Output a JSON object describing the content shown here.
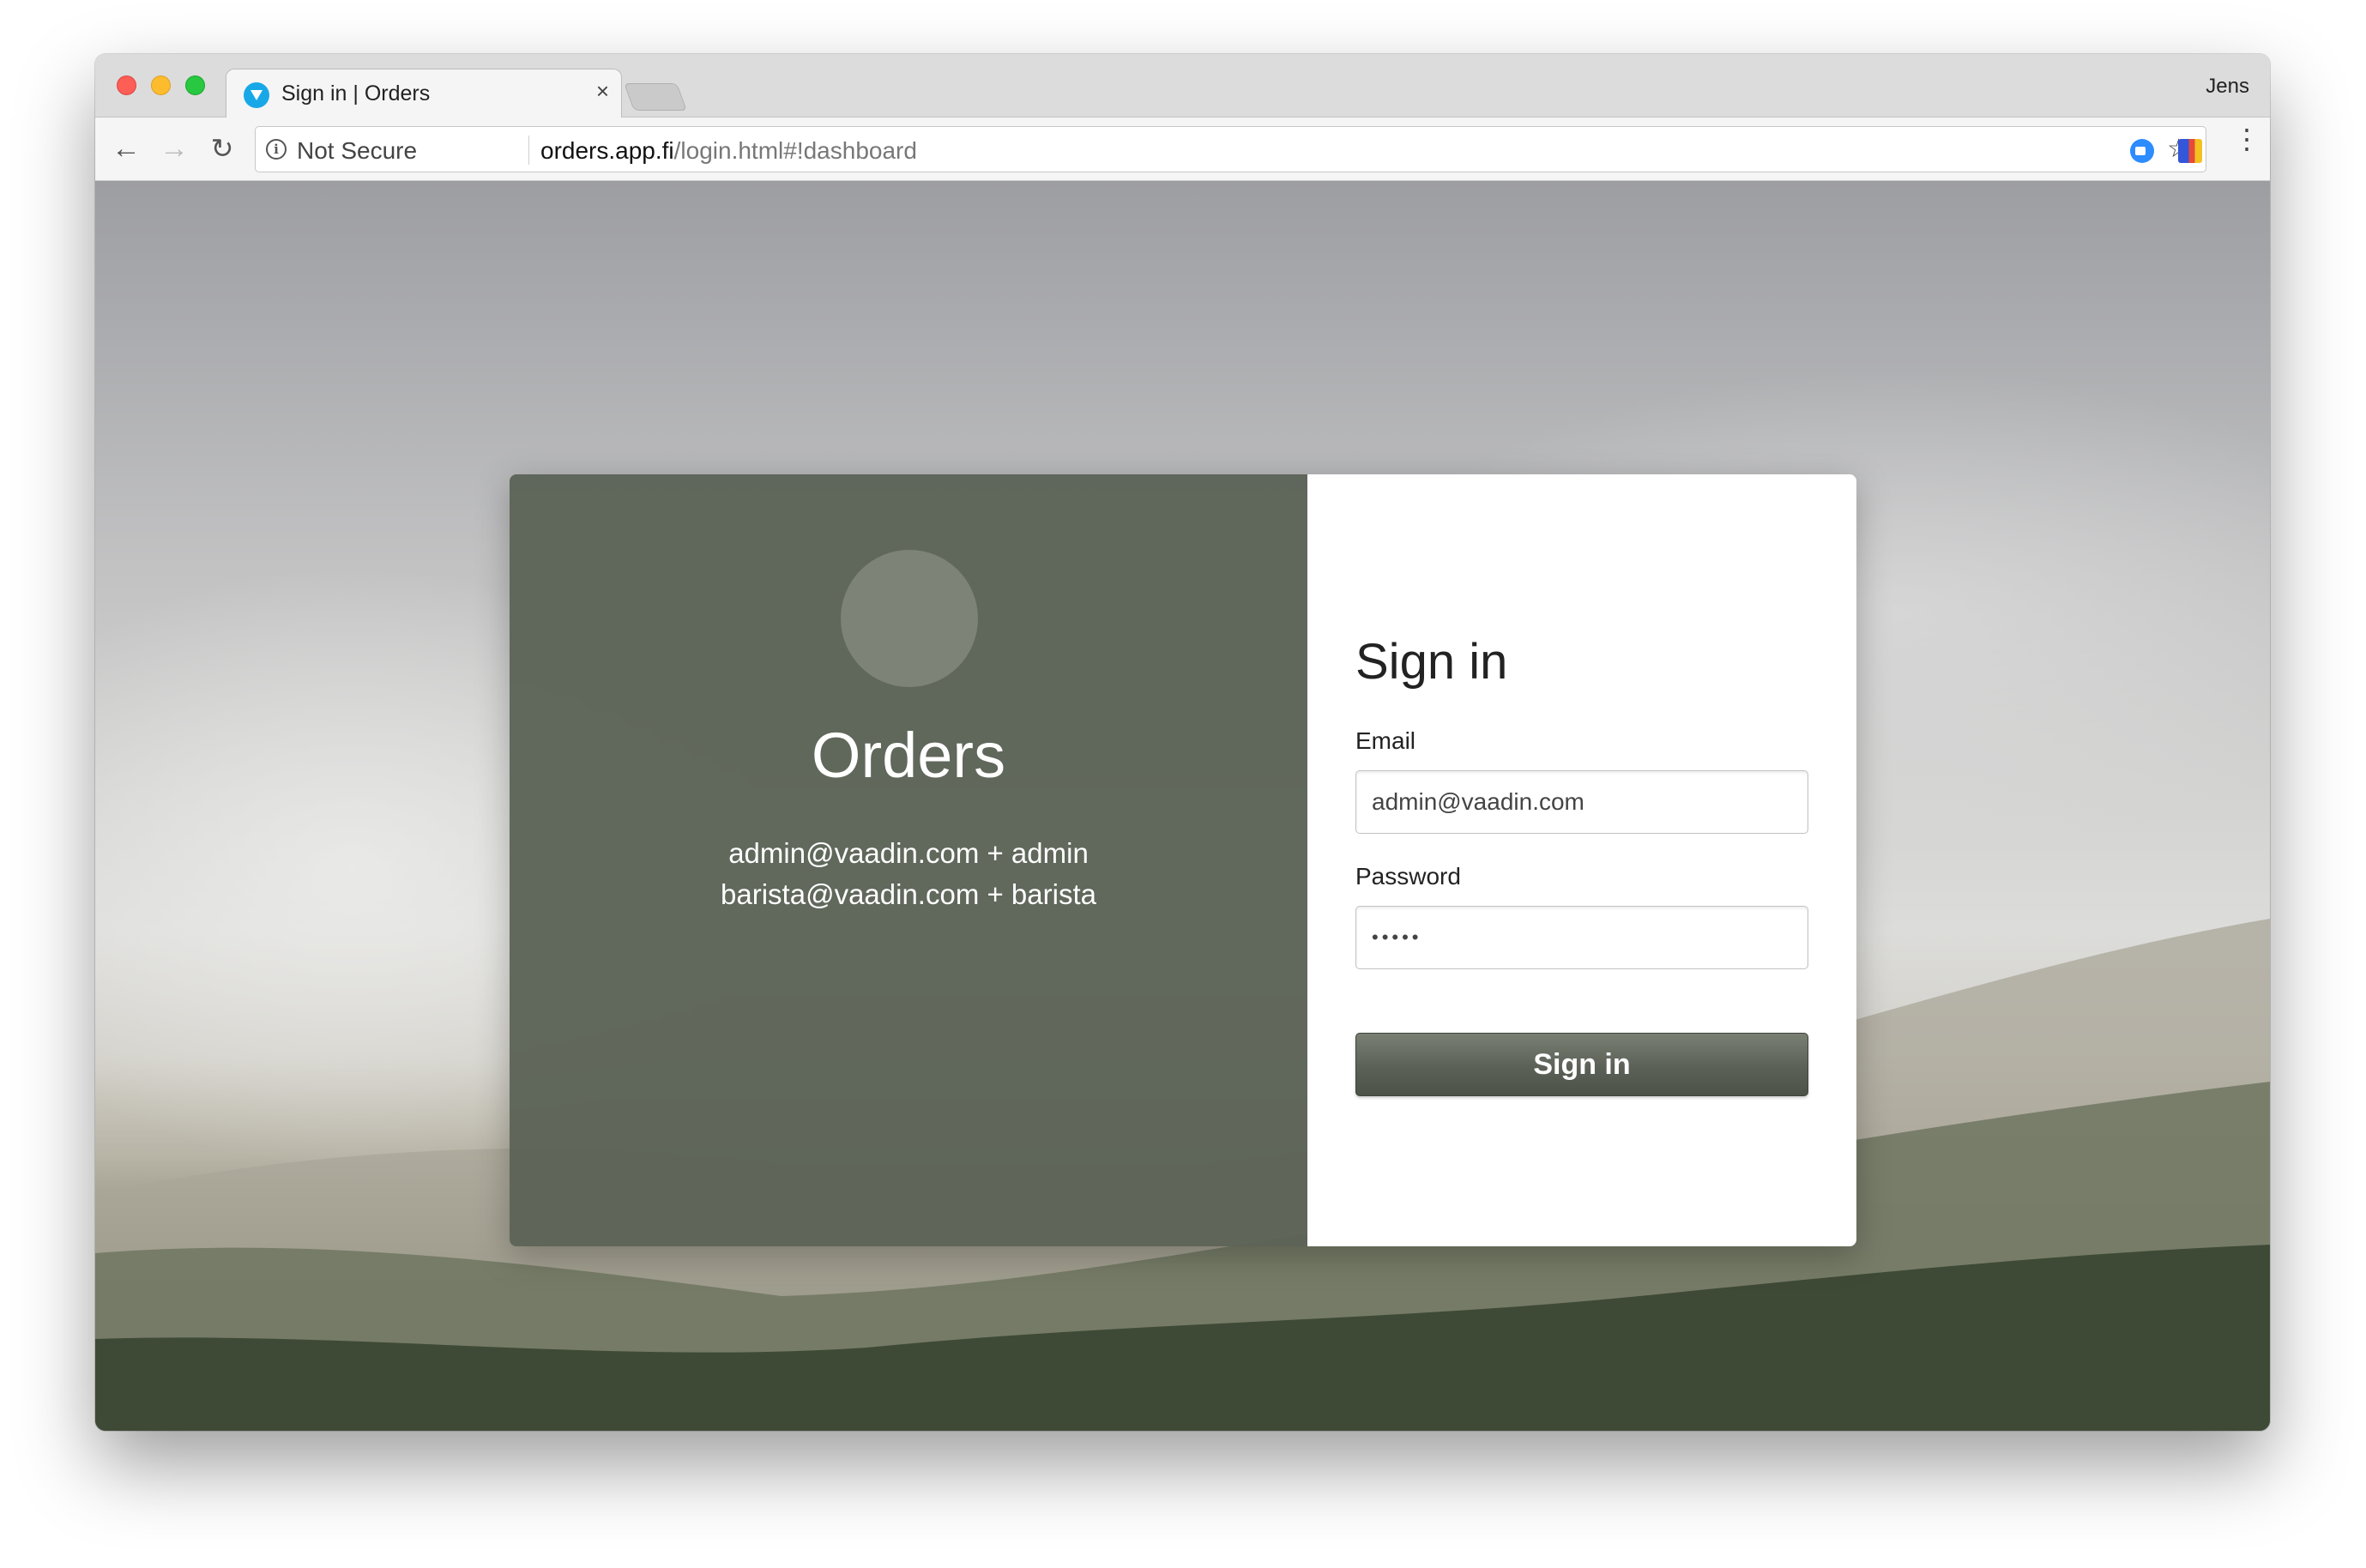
{
  "browser": {
    "tab_title": "Sign in | Orders",
    "tab_close_glyph": "×",
    "profile_name": "Jens",
    "security_label": "Not Secure",
    "url_host": "orders.app.fi",
    "url_path": "/login.html#!dashboard",
    "nav": {
      "back": "←",
      "forward": "→",
      "reload": "↻"
    },
    "icons": {
      "favicon": "vaadin-favicon-icon",
      "info": "info-icon",
      "key": "key-icon",
      "star": "star-icon",
      "zoom_extension": "zoom-extension-icon",
      "flag_extension": "flag-extension-icon",
      "menu": "menu-dots-icon"
    },
    "info_glyph": "i",
    "key_glyph": "⚷",
    "star_glyph": "☆",
    "menu_glyph": "⋮"
  },
  "login": {
    "app_name": "Orders",
    "credentials": [
      "admin@vaadin.com + admin",
      "barista@vaadin.com + barista"
    ],
    "form_title": "Sign in",
    "email_label": "Email",
    "email_value": "admin@vaadin.com",
    "password_label": "Password",
    "password_value": "•••••",
    "submit_label": "Sign in"
  },
  "colors": {
    "info_panel": "#5c6356",
    "button": "#5b6156",
    "favicon": "#18a8e8"
  }
}
